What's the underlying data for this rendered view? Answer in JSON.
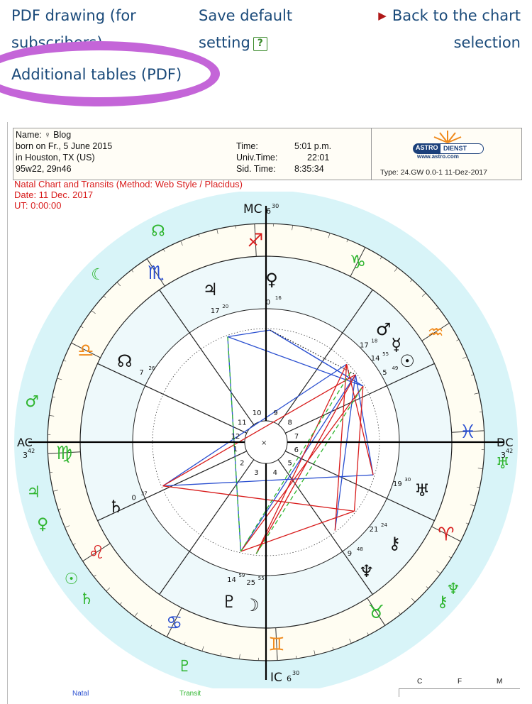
{
  "nav": {
    "pdf_drawing_line1": "PDF drawing (for",
    "pdf_drawing_line2": "subscribers)",
    "save_default_line1": "Save default",
    "save_default_line2": "setting",
    "help_glyph": "?",
    "back_line1": "Back to the chart",
    "back_line2": "selection",
    "additional_tables": "Additional tables (PDF)"
  },
  "header": {
    "name_label": "Name:",
    "name_symbol": "♀",
    "name_value": "Blog",
    "born": "born on Fr., 5 June 2015",
    "place": "in Houston, TX (US)",
    "coords": "95w22, 29n46",
    "time_label": "Time:",
    "time_value": "5:01 p.m.",
    "univ_label": "Univ.Time:",
    "univ_value": "22:01",
    "sid_label": "Sid. Time:",
    "sid_value": "8:35:34",
    "logo_astro": "ASTRO",
    "logo_dienst": "DIENST",
    "logo_url": "www.astro.com",
    "type_line": "Type: 24.GW  0.0-1  11-Dez-2017"
  },
  "chart_title": {
    "line1": "Natal Chart and Transits  (Method: Web Style / Placidus)",
    "line2": "Date: 11 Dec. 2017",
    "line3": "UT:  0:00:00"
  },
  "wheel": {
    "angles": {
      "mc": "MC",
      "ic": "IC",
      "ac": "AC",
      "dc": "DC"
    },
    "angle_degrees": {
      "mc": "6",
      "mc_min": "30",
      "ic": "6",
      "ic_min": "30",
      "ac": "3",
      "ac_min": "42",
      "dc": "3",
      "dc_min": "42"
    },
    "house_numbers": [
      "1",
      "2",
      "3",
      "4",
      "5",
      "6",
      "7",
      "8",
      "9",
      "10",
      "11",
      "12"
    ],
    "signs": [
      "♈",
      "♉",
      "♊",
      "♋",
      "♌",
      "♍",
      "♎",
      "♏",
      "♐",
      "♑",
      "♒",
      "♓"
    ],
    "natal_planets": [
      {
        "glyph": "♀",
        "deg": "0",
        "min": "16"
      },
      {
        "glyph": "♃",
        "deg": "17",
        "min": "20"
      },
      {
        "glyph": "☊",
        "deg": "7",
        "min": "26"
      },
      {
        "glyph": "♂",
        "deg": "17",
        "min": "18"
      },
      {
        "glyph": "☿",
        "deg": "14",
        "min": "55"
      },
      {
        "glyph": "☉",
        "deg": "5",
        "min": "49"
      },
      {
        "glyph": "♅",
        "deg": "19",
        "min": "30"
      },
      {
        "glyph": "⚷",
        "deg": "21",
        "min": "24"
      },
      {
        "glyph": "♆",
        "deg": "9",
        "min": "48"
      },
      {
        "glyph": "♄",
        "deg": "0",
        "min": "37"
      },
      {
        "glyph": "♇",
        "deg": "14",
        "min": "59"
      },
      {
        "glyph": "☽",
        "deg": "25",
        "min": "55"
      }
    ],
    "transit_planets": [
      "☊",
      "☾",
      "♂",
      "♃",
      "♀",
      "☉",
      "♄",
      "♇",
      "♅",
      "♆",
      "⚷"
    ]
  },
  "bottom": {
    "natal": "Natal",
    "transit": "Transit",
    "c": "C",
    "f": "F",
    "m": "M"
  },
  "colors": {
    "nav_text": "#1a4a7a",
    "highlight_oval": "#c465d8",
    "natal_red": "#d81c1c",
    "transit_green": "#2fb52f",
    "aspect_blue": "#2a4fd0",
    "outer_ring": "#d8f4f8"
  }
}
